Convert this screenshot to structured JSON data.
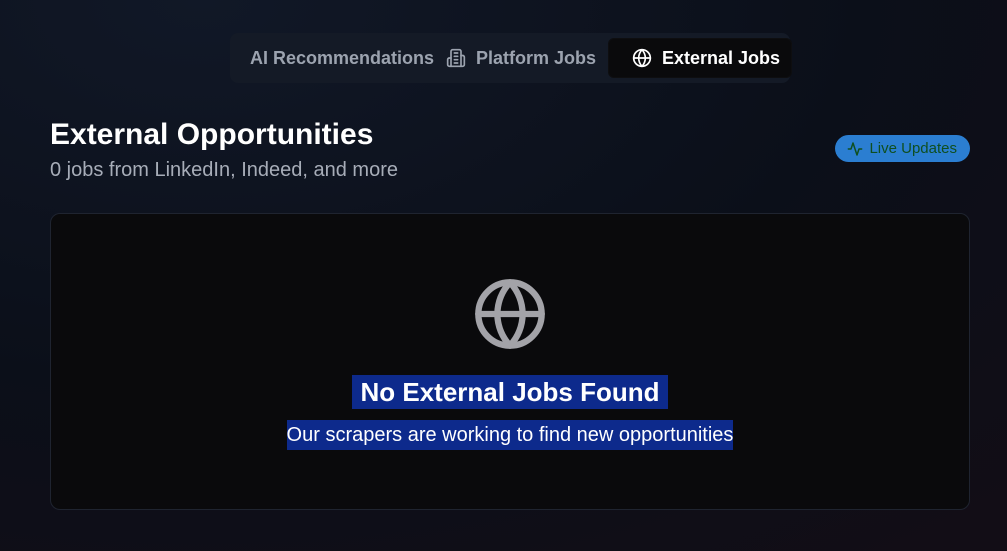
{
  "tabs": [
    {
      "label": "AI Recommendations",
      "icon": "",
      "active": false
    },
    {
      "label": "Platform Jobs",
      "icon": "building-icon",
      "active": false
    },
    {
      "label": "External Jobs",
      "icon": "globe-icon",
      "active": true
    }
  ],
  "header": {
    "title": "External Opportunities",
    "subtitle": "0 jobs from LinkedIn, Indeed, and more",
    "badge": {
      "label": "Live Updates",
      "icon": "activity-icon",
      "bg": "#2b7ed1",
      "fg": "#0f4f1f"
    }
  },
  "empty_state": {
    "icon": "globe-icon",
    "title": "No External Jobs Found",
    "subtitle": "Our scrapers are working to find new opportunities",
    "highlight_color": "#0d2a8c"
  }
}
